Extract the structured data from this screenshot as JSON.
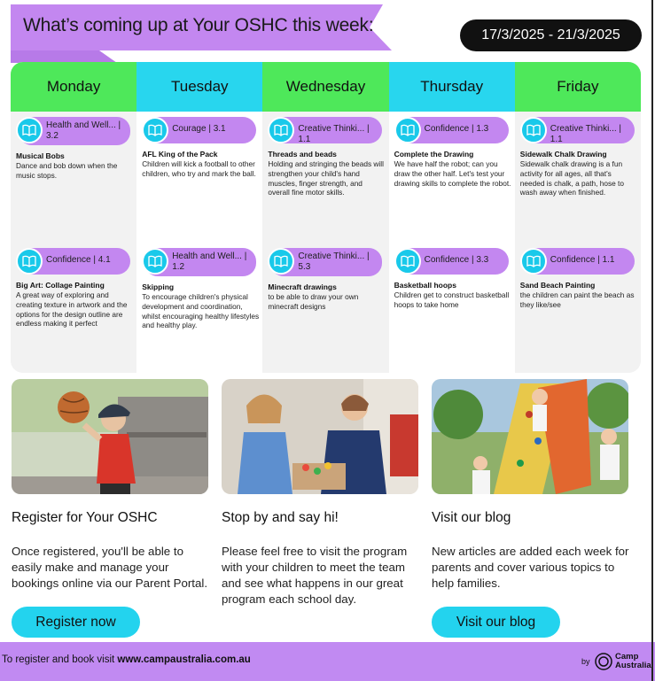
{
  "header": {
    "title": "What’s coming up at Your OSHC this week:",
    "date_range": "17/3/2025 - 21/3/2025"
  },
  "colors": {
    "green": "#4ee85a",
    "cyan": "#28d6ee",
    "purple": "#c387f0",
    "black": "#111111"
  },
  "days": [
    {
      "name": "Monday",
      "activities": [
        {
          "tag": "Health and Well... | 3.2",
          "title": "Musical Bobs",
          "desc": "Dance and bob down when the music stops."
        },
        {
          "tag": "Confidence | 4.1",
          "title": "Big Art: Collage Painting",
          "desc": "A great way of exploring and creating texture in artwork and the options for the design outline are endless making it perfect"
        }
      ]
    },
    {
      "name": "Tuesday",
      "activities": [
        {
          "tag": "Courage | 3.1",
          "title": "AFL King of the Pack",
          "desc": "Children will kick a football to other children, who try and mark the ball."
        },
        {
          "tag": "Health and Well... | 1.2",
          "title": "Skipping",
          "desc": "To encourage children's physical development and coordination, whilst encouraging healthy lifestyles and healthy play."
        }
      ]
    },
    {
      "name": "Wednesday",
      "activities": [
        {
          "tag": "Creative Thinki... | 1.1",
          "title": "Threads and beads",
          "desc": "Holding and stringing the beads will strengthen your child's hand muscles, finger strength, and overall fine motor skills."
        },
        {
          "tag": "Creative Thinki... | 5.3",
          "title": "Minecraft drawings",
          "desc": "to be able to draw your own minecraft designs"
        }
      ]
    },
    {
      "name": "Thursday",
      "activities": [
        {
          "tag": "Confidence | 1.3",
          "title": "Complete the Drawing",
          "desc": "We have half the robot; can you draw the other half. Let's test your drawing skills to complete the robot."
        },
        {
          "tag": "Confidence | 3.3",
          "title": "Basketball hoops",
          "desc": "Children get to construct basketball hoops to take home"
        }
      ]
    },
    {
      "name": "Friday",
      "activities": [
        {
          "tag": "Creative Thinki... | 1.1",
          "title": "Sidewalk Chalk Drawing",
          "desc": "Sidewalk chalk drawing is a fun activity for all ages, all that's needed is chalk, a path, hose to wash away when finished."
        },
        {
          "tag": "Confidence | 1.1",
          "title": "Sand Beach Painting",
          "desc": "the children can paint the beach as they like/see"
        }
      ]
    }
  ],
  "cards": [
    {
      "title": "Register for Your OSHC",
      "body": "Once registered, you'll be able to easily make and manage your bookings online via our Parent Portal.",
      "button": "Register now"
    },
    {
      "title": "Stop by and say hi!",
      "body": "Please feel free to visit the program with your children to meet the team and see what happens in our great program each school day."
    },
    {
      "title": "Visit our blog",
      "body": "New articles are added each week for parents and cover various topics to help families.",
      "button": "Visit our blog"
    }
  ],
  "footer": {
    "prefix": "To register and book visit ",
    "link": "www.campaustralia.com.au",
    "by": "by",
    "brand_line1": "Camp",
    "brand_line2": "Australia"
  }
}
